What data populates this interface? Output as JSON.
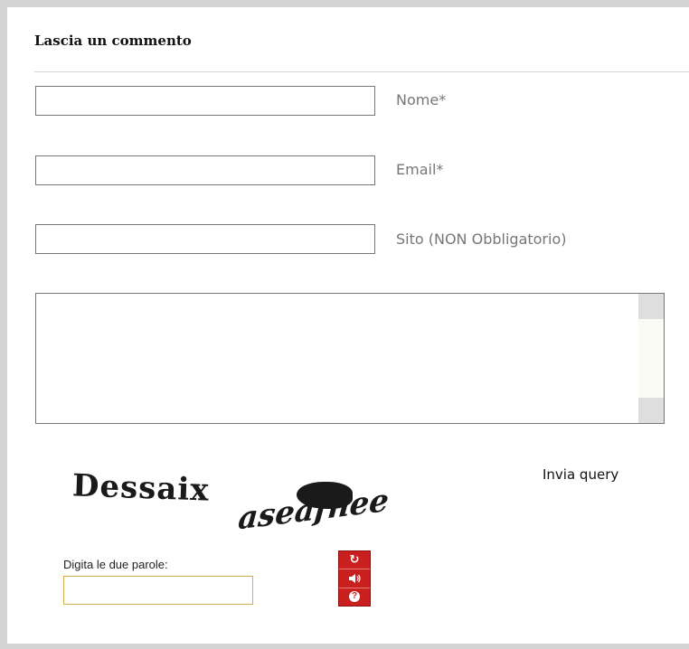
{
  "form": {
    "heading": "Lascia un commento",
    "fields": [
      {
        "label": "Nome*",
        "value": ""
      },
      {
        "label": "Email*",
        "value": ""
      },
      {
        "label": "Sito (NON Obbligatorio)",
        "value": ""
      }
    ],
    "comment_value": "",
    "submit_label": "Invia query"
  },
  "captcha": {
    "word1": "Dessaix",
    "word2": "aseafnee",
    "prompt": "Digita le due parole:",
    "input_value": "",
    "controls": [
      "refresh-icon",
      "audio-icon",
      "help-icon"
    ],
    "controls_color": "#c9201f"
  }
}
